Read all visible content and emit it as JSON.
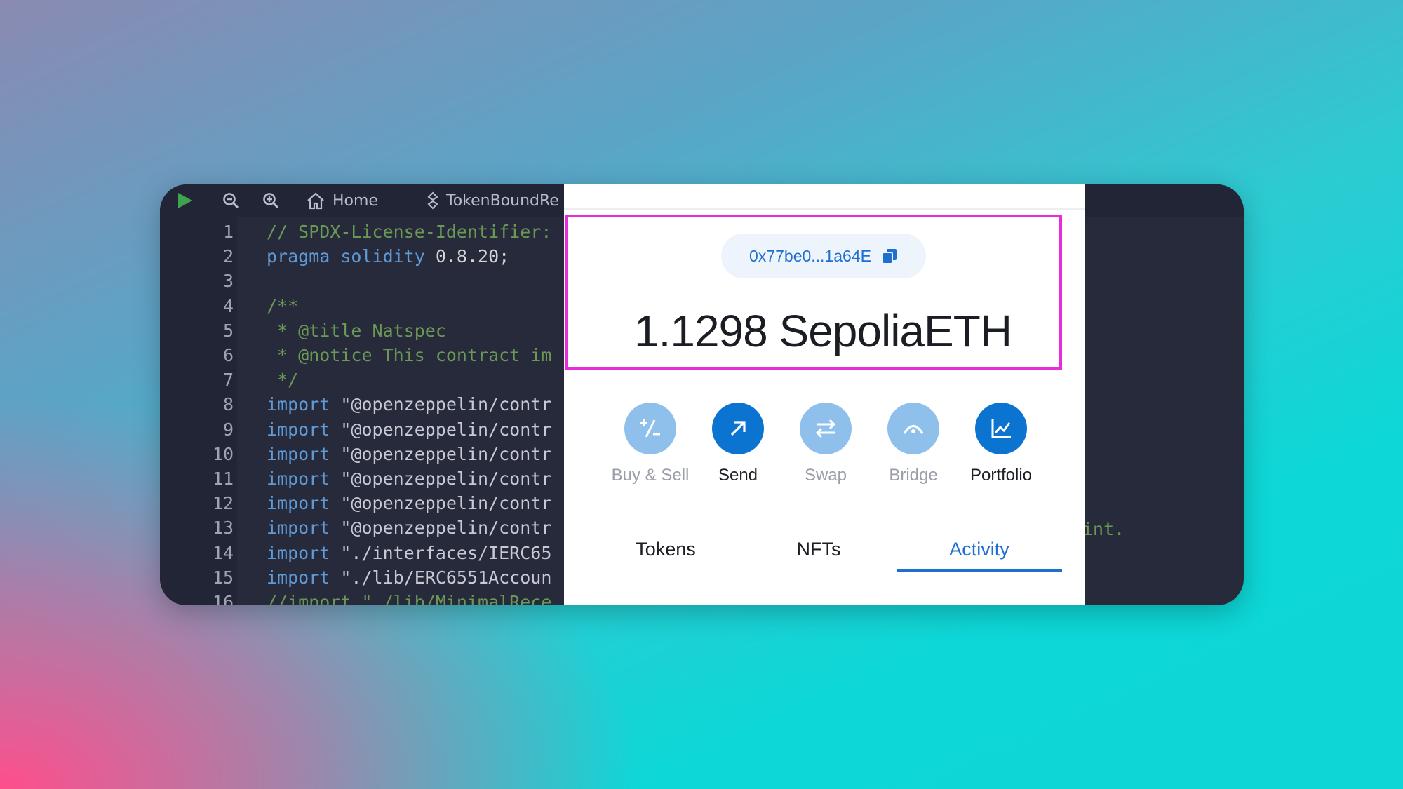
{
  "editor": {
    "toolbar": {
      "home_label": "Home",
      "file_tab_label": "TokenBoundRe"
    },
    "lines": [
      {
        "num": "1",
        "parts": [
          {
            "cls": "c-comment",
            "text": "// SPDX-License-Identifier:"
          }
        ]
      },
      {
        "num": "2",
        "parts": [
          {
            "cls": "c-kw",
            "text": "pragma solidity "
          },
          {
            "cls": "c-plain",
            "text": "0.8.20;"
          }
        ]
      },
      {
        "num": "3",
        "parts": []
      },
      {
        "num": "4",
        "parts": [
          {
            "cls": "c-comment",
            "text": "/**"
          }
        ]
      },
      {
        "num": "5",
        "parts": [
          {
            "cls": "c-comment",
            "text": " * @title Natspec"
          }
        ]
      },
      {
        "num": "6",
        "parts": [
          {
            "cls": "c-comment",
            "text": " * @notice This contract im"
          }
        ]
      },
      {
        "num": "7",
        "parts": [
          {
            "cls": "c-comment",
            "text": " */"
          }
        ]
      },
      {
        "num": "8",
        "parts": [
          {
            "cls": "c-kw",
            "text": "import "
          },
          {
            "cls": "c-str",
            "text": "\"@openzeppelin/contr"
          }
        ]
      },
      {
        "num": "9",
        "parts": [
          {
            "cls": "c-kw",
            "text": "import "
          },
          {
            "cls": "c-str",
            "text": "\"@openzeppelin/contr"
          }
        ]
      },
      {
        "num": "10",
        "parts": [
          {
            "cls": "c-kw",
            "text": "import "
          },
          {
            "cls": "c-str",
            "text": "\"@openzeppelin/contr"
          }
        ]
      },
      {
        "num": "11",
        "parts": [
          {
            "cls": "c-kw",
            "text": "import "
          },
          {
            "cls": "c-str",
            "text": "\"@openzeppelin/contr"
          }
        ]
      },
      {
        "num": "12",
        "parts": [
          {
            "cls": "c-kw",
            "text": "import "
          },
          {
            "cls": "c-str",
            "text": "\"@openzeppelin/contr"
          }
        ]
      },
      {
        "num": "13",
        "parts": [
          {
            "cls": "c-kw",
            "text": "import "
          },
          {
            "cls": "c-str",
            "text": "\"@openzeppelin/contr"
          }
        ]
      },
      {
        "num": "14",
        "parts": [
          {
            "cls": "c-kw",
            "text": "import "
          },
          {
            "cls": "c-str",
            "text": "\"./interfaces/IERC65"
          }
        ]
      },
      {
        "num": "15",
        "parts": [
          {
            "cls": "c-kw",
            "text": "import "
          },
          {
            "cls": "c-str",
            "text": "\"./lib/ERC6551Accoun"
          }
        ]
      },
      {
        "num": "16",
        "parts": [
          {
            "cls": "c-comment",
            "text": "//import \"./lib/MinimalRece"
          }
        ]
      }
    ],
    "overflow_text": "int."
  },
  "wallet": {
    "address": "0x77be0...1a64E",
    "balance": "1.1298 SepoliaETH",
    "actions": {
      "buy_sell": "Buy & Sell",
      "send": "Send",
      "swap": "Swap",
      "bridge": "Bridge",
      "portfolio": "Portfolio"
    },
    "tabs": {
      "tokens": "Tokens",
      "nfts": "NFTs",
      "activity": "Activity"
    },
    "active_tab": "Activity",
    "colors": {
      "accent": "#1f6fd1",
      "highlight_border": "#ea2bd9",
      "action_active": "#0b74d1",
      "action_dim": "#8ec0eb"
    }
  }
}
